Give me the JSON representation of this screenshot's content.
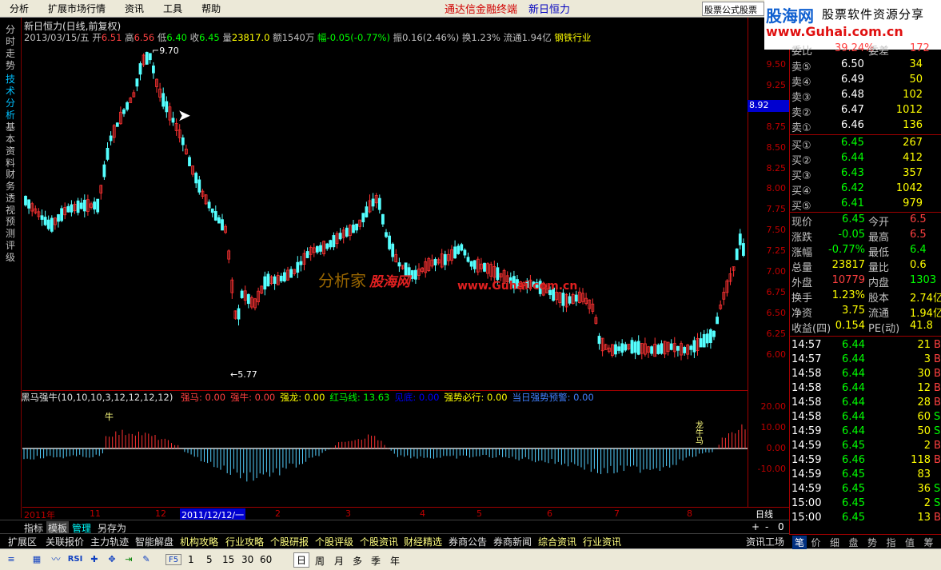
{
  "menu": {
    "items": [
      "分析",
      "扩展市场行情",
      "资讯",
      "工具",
      "帮助"
    ],
    "promo": "通达信金融终端",
    "stock_name": "新日恒力",
    "tab_btn": "股票公式股票"
  },
  "banner": {
    "logo": "股海网",
    "slogan": "股票软件资源分享",
    "url": "www.Guhai.com.cn"
  },
  "vtabs": [
    "分时走势",
    "技术分析",
    "基本资料",
    "财务透视",
    "预测评级"
  ],
  "chart": {
    "title": "新日恒力(日线,前复权)",
    "date": "2013/03/15/五",
    "open_label": "开",
    "open": "6.51",
    "high_label": "高",
    "high": "6.56",
    "low_label": "低",
    "low": "6.40",
    "close_label": "收",
    "close": "6.45",
    "vol_label": "量",
    "vol": "23817.0",
    "amount": "额1540万",
    "change": "幅-0.05(-0.77%)",
    "amp": "振0.16(2.46%)",
    "turnover": "换1.23%",
    "float": "流通1.94亿",
    "industry": "钢铁行业",
    "y_ticks": [
      "9.50",
      "9.25",
      "9.00",
      "8.75",
      "8.50",
      "8.25",
      "8.00",
      "7.75",
      "7.50",
      "7.25",
      "7.00",
      "6.75",
      "6.50",
      "6.25",
      "6.00"
    ],
    "price_tag": "8.92",
    "high_mark": "9.70",
    "low_mark": "5.77",
    "watermark1": "分析家",
    "watermark2": "股海网",
    "watermark3": "www.Guhai.com.cn"
  },
  "indicator": {
    "name": "黑马强牛(10,10,10,3,12,12,12,12)",
    "items": [
      {
        "label": "强马:",
        "value": "0.00",
        "color": "#ff4040"
      },
      {
        "label": "强牛:",
        "value": "0.00",
        "color": "#ff4040"
      },
      {
        "label": "强龙:",
        "value": "0.00",
        "color": "#ffff00"
      },
      {
        "label": "红马线:",
        "value": "13.63",
        "color": "#00ff00"
      },
      {
        "label": "见底:",
        "value": "0.00",
        "color": "#0000ff"
      },
      {
        "label": "强势必行:",
        "value": "0.00",
        "color": "#ffff00"
      },
      {
        "label": "当日强势预警:",
        "value": "0.00",
        "color": "#4080ff"
      }
    ],
    "y_ticks": [
      "20.00",
      "10.00",
      "0.00",
      "-10.00"
    ],
    "mark_niu": "牛",
    "mark_long": "龙牛马"
  },
  "dates": {
    "labels": [
      "2011年",
      "11",
      "12",
      "2011/12/12/一",
      "2",
      "3",
      "4",
      "5",
      "6",
      "7",
      "8"
    ],
    "period": "日线",
    "zoom": [
      "+",
      "-",
      "0"
    ]
  },
  "tabs1": [
    "指标",
    "模板",
    "管理",
    "另存为"
  ],
  "tabs2": [
    "扩展区",
    "关联报价",
    "主力轨迹",
    "智能解盘",
    "机构攻略",
    "行业攻略",
    "个股研报",
    "个股评级",
    "个股资讯",
    "财经精选",
    "券商公告",
    "券商新闻",
    "综合资讯",
    "行业资讯",
    "资讯工场"
  ],
  "toolbar": {
    "icons": [
      "chart-icon",
      "rsi-icon",
      "cross-icon",
      "move-icon",
      "pen-icon",
      "f5-icon"
    ],
    "rsi": "RSI",
    "f5": "F5",
    "periods": [
      "1",
      "5",
      "15",
      "30",
      "60",
      "日",
      "周",
      "月",
      "多",
      "季",
      "年"
    ]
  },
  "quote": {
    "ratio_label": "委比",
    "ratio": "39.24%",
    "diff_label": "委差",
    "diff": "172",
    "sells": [
      {
        "label": "卖⑤",
        "price": "6.50",
        "vol": "34"
      },
      {
        "label": "卖④",
        "price": "6.49",
        "vol": "50"
      },
      {
        "label": "卖③",
        "price": "6.48",
        "vol": "102"
      },
      {
        "label": "卖②",
        "price": "6.47",
        "vol": "1012"
      },
      {
        "label": "卖①",
        "price": "6.46",
        "vol": "136"
      }
    ],
    "buys": [
      {
        "label": "买①",
        "price": "6.45",
        "vol": "267"
      },
      {
        "label": "买②",
        "price": "6.44",
        "vol": "412"
      },
      {
        "label": "买③",
        "price": "6.43",
        "vol": "357"
      },
      {
        "label": "买④",
        "price": "6.42",
        "vol": "1042"
      },
      {
        "label": "买⑤",
        "price": "6.41",
        "vol": "979"
      }
    ],
    "stats": [
      {
        "l1": "现价",
        "v1": "6.45",
        "c1": "#00ff00",
        "l2": "今开",
        "v2": "6.5",
        "c2": "#ff4040"
      },
      {
        "l1": "涨跌",
        "v1": "-0.05",
        "c1": "#00ff00",
        "l2": "最高",
        "v2": "6.5",
        "c2": "#ff4040"
      },
      {
        "l1": "涨幅",
        "v1": "-0.77%",
        "c1": "#00ff00",
        "l2": "最低",
        "v2": "6.4",
        "c2": "#00ff00"
      },
      {
        "l1": "总量",
        "v1": "23817",
        "c1": "#ffff00",
        "l2": "量比",
        "v2": "0.6",
        "c2": "#ffff00"
      },
      {
        "l1": "外盘",
        "v1": "10779",
        "c1": "#ff4040",
        "l2": "内盘",
        "v2": "1303",
        "c2": "#00ff00"
      },
      {
        "l1": "换手",
        "v1": "1.23%",
        "c1": "#ffff00",
        "l2": "股本",
        "v2": "2.74亿",
        "c2": "#ffff00"
      },
      {
        "l1": "净资",
        "v1": "3.75",
        "c1": "#ffff00",
        "l2": "流通",
        "v2": "1.94亿",
        "c2": "#ffff00"
      },
      {
        "l1": "收益(四)",
        "v1": "0.154",
        "c1": "#ffff00",
        "l2": "PE(动)",
        "v2": "41.8",
        "c2": "#ffff00"
      }
    ],
    "ticks": [
      {
        "t": "14:57",
        "p": "6.44",
        "v": "21",
        "s": "B"
      },
      {
        "t": "14:57",
        "p": "6.44",
        "v": "3",
        "s": "B"
      },
      {
        "t": "14:58",
        "p": "6.44",
        "v": "30",
        "s": "B"
      },
      {
        "t": "14:58",
        "p": "6.44",
        "v": "12",
        "s": "B"
      },
      {
        "t": "14:58",
        "p": "6.44",
        "v": "28",
        "s": "B"
      },
      {
        "t": "14:58",
        "p": "6.44",
        "v": "60",
        "s": "S"
      },
      {
        "t": "14:59",
        "p": "6.44",
        "v": "50",
        "s": "S"
      },
      {
        "t": "14:59",
        "p": "6.45",
        "v": "2",
        "s": "B"
      },
      {
        "t": "14:59",
        "p": "6.46",
        "v": "118",
        "s": "B"
      },
      {
        "t": "14:59",
        "p": "6.45",
        "v": "83",
        "s": ""
      },
      {
        "t": "14:59",
        "p": "6.45",
        "v": "36",
        "s": "S"
      },
      {
        "t": "15:00",
        "p": "6.45",
        "v": "2",
        "s": "S"
      },
      {
        "t": "15:00",
        "p": "6.45",
        "v": "13",
        "s": "B"
      }
    ]
  },
  "rtabs": [
    "笔",
    "价",
    "细",
    "盘",
    "势",
    "指",
    "值",
    "筹"
  ]
}
